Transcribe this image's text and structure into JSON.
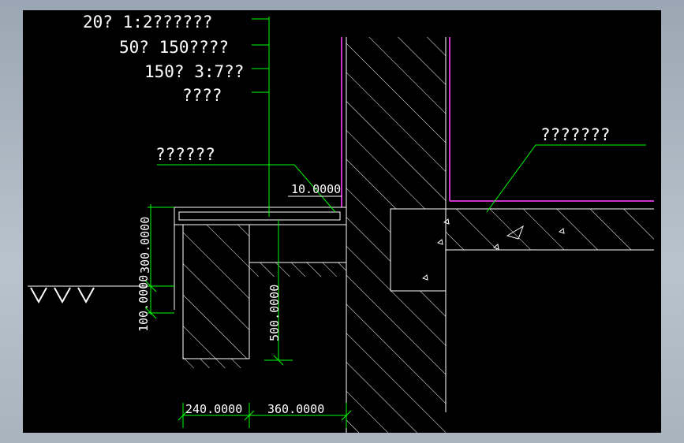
{
  "labels": {
    "layer1": "20厚1:2水泥砂浆层",
    "layer2": "50厚C15混凝土",
    "layer3": "150厚3:7灰土",
    "layer4": "素土夯实",
    "apron": "散水宽同屋檐",
    "floor": "室内地面构造做法",
    "display_layer1": "20? 1:2??????",
    "display_layer2": "50? 150????",
    "display_layer3": "150? 3:7??",
    "display_layer4": "????",
    "display_apron": "??????",
    "display_floor": "???????"
  },
  "dimensions": {
    "elevation": "10.0000",
    "apron_height": "100.0000",
    "step_height": "300.0000",
    "wall_depth": "500.0000",
    "base_width": "240.0000",
    "offset_width": "360.0000"
  },
  "colors": {
    "background": "#000000",
    "linework": "#ffffff",
    "leader": "#00ff00",
    "membrane": "#cc33cc"
  }
}
